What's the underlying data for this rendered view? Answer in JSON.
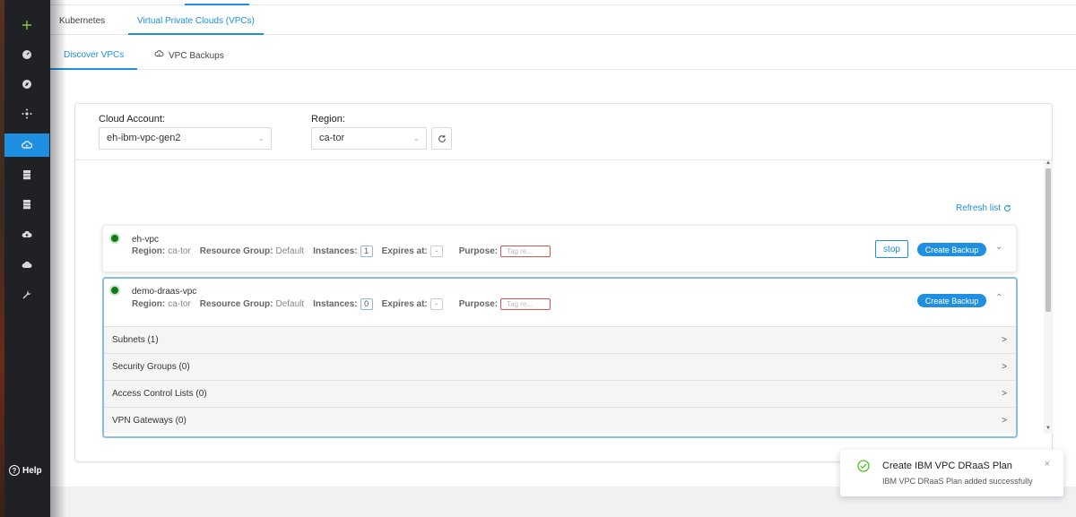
{
  "sidebar": {
    "items": [
      {
        "icon": "plus-icon",
        "active": false
      },
      {
        "icon": "dashboard-icon",
        "active": false
      },
      {
        "icon": "compass-icon",
        "active": false
      },
      {
        "icon": "cluster-icon",
        "active": false
      },
      {
        "icon": "cloud-eye-icon",
        "active": true
      },
      {
        "icon": "server-icon",
        "active": false
      },
      {
        "icon": "server-stack-icon",
        "active": false
      },
      {
        "icon": "cloud-upload-icon",
        "active": false
      },
      {
        "icon": "cloud-icon",
        "active": false
      },
      {
        "icon": "wrench-icon",
        "active": false
      }
    ],
    "help_label": "Help"
  },
  "tabs_primary": [
    "Kubernetes",
    "Virtual Private Clouds (VPCs)"
  ],
  "tabs_secondary": [
    "Discover VPCs",
    "VPC Backups"
  ],
  "filters": {
    "cloud_account_label": "Cloud Account:",
    "cloud_account_value": "eh-ibm-vpc-gen2",
    "region_label": "Region:",
    "region_value": "ca-tor"
  },
  "refresh_list_label": "Refresh list",
  "vpcs": [
    {
      "name": "eh-vpc",
      "region_label": "Region:",
      "region": "ca-tor",
      "rg_label": "Resource Group:",
      "rg": "Default",
      "instances_label": "Instances:",
      "instances": "1",
      "expires_label": "Expires at:",
      "expires": "-",
      "purpose_label": "Purpose:",
      "tag_placeholder": "Tag re...",
      "stop_label": "stop",
      "create_label": "Create Backup"
    },
    {
      "name": "demo-draas-vpc",
      "region_label": "Region:",
      "region": "ca-tor",
      "rg_label": "Resource Group:",
      "rg": "Default",
      "instances_label": "Instances:",
      "instances": "0",
      "expires_label": "Expires at:",
      "expires": "-",
      "purpose_label": "Purpose:",
      "tag_placeholder": "Tag re...",
      "create_label": "Create Backup",
      "sections": [
        "Subnets (1)",
        "Security Groups (0)",
        "Access Control Lists (0)",
        "VPN Gateways (0)"
      ]
    }
  ],
  "toast": {
    "title": "Create IBM VPC DRaaS Plan",
    "message": "IBM VPC DRaaS Plan added successfully"
  },
  "colors": {
    "accent": "#1e8fe1",
    "sidebar": "#1f2125",
    "success": "#137a1a",
    "danger": "#d9534f"
  }
}
